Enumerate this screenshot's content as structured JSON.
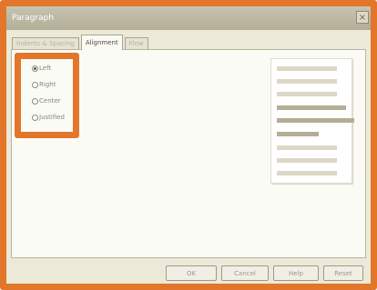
{
  "dialog": {
    "title": "Paragraph",
    "close_glyph": "×"
  },
  "tabs": [
    {
      "label": "Indents & Spacing",
      "active": false
    },
    {
      "label": "Alignment",
      "active": true
    },
    {
      "label": "Flow",
      "active": false
    }
  ],
  "alignment_options": [
    {
      "label": "Left",
      "checked": true
    },
    {
      "label": "Right",
      "checked": false
    },
    {
      "label": "Center",
      "checked": false
    },
    {
      "label": "Justified",
      "checked": false
    }
  ],
  "buttons": {
    "ok": "OK",
    "cancel": "Cancel",
    "help": "Help",
    "reset": "Reset"
  },
  "colors": {
    "highlight": "#e2762a",
    "dialog_bg": "#ece9d8"
  }
}
